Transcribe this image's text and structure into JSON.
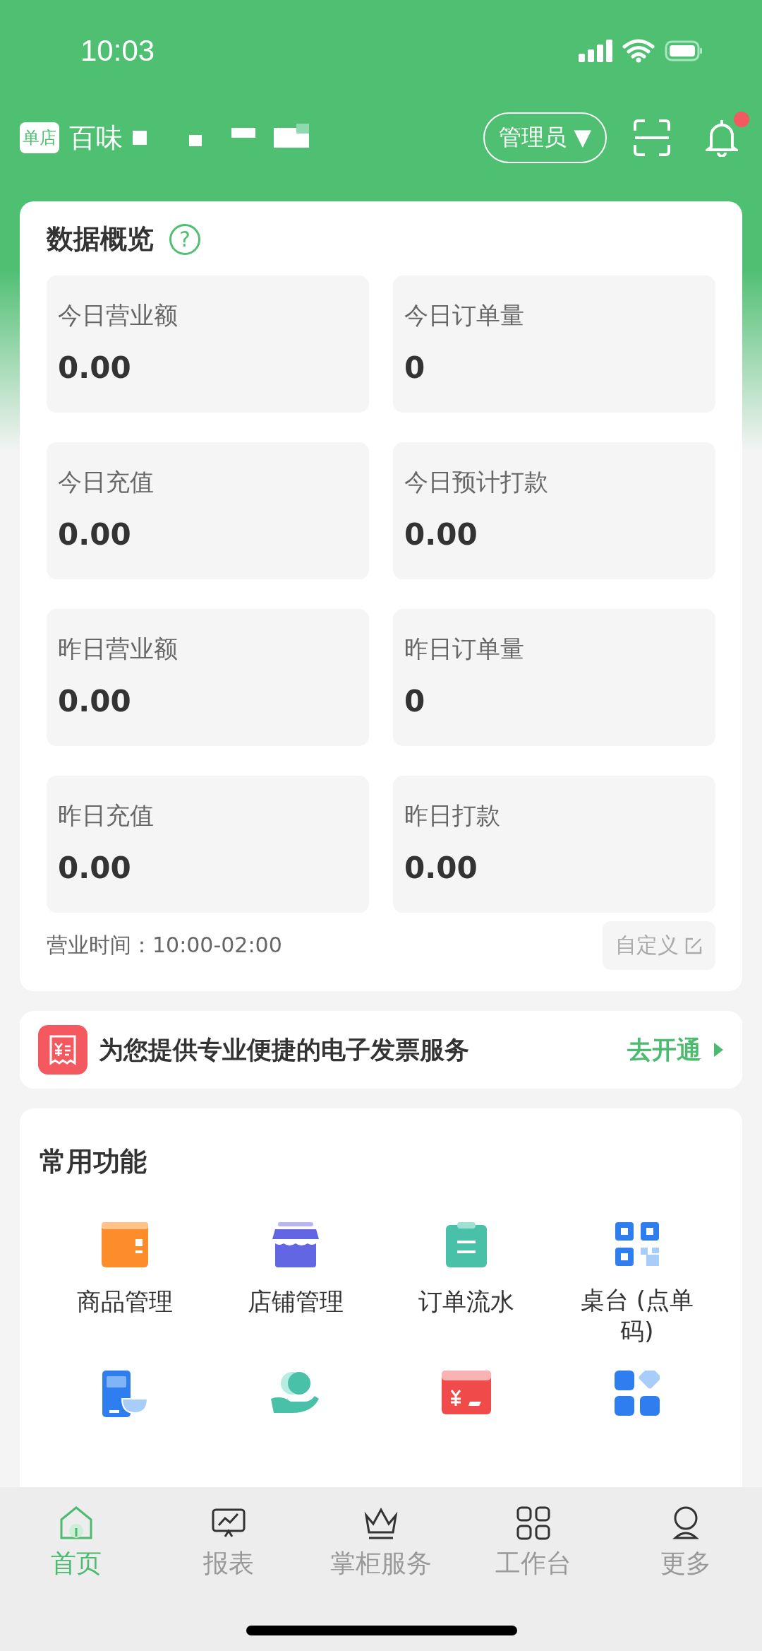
{
  "status_bar": {
    "time": "10:03"
  },
  "header": {
    "store_tag": "单店",
    "store_name": "百味",
    "role_button": "管理员 ▼",
    "notification_dot": true
  },
  "overview": {
    "title": "数据概览",
    "help_icon": "?",
    "tiles": [
      {
        "label": "今日营业额",
        "value": "0.00"
      },
      {
        "label": "今日订单量",
        "value": "0"
      },
      {
        "label": "今日充值",
        "value": "0.00"
      },
      {
        "label": "今日预计打款",
        "value": "0.00"
      },
      {
        "label": "昨日营业额",
        "value": "0.00"
      },
      {
        "label": "昨日订单量",
        "value": "0"
      },
      {
        "label": "昨日充值",
        "value": "0.00"
      },
      {
        "label": "昨日打款",
        "value": "0.00"
      }
    ],
    "business_hours": "营业时间：10:00-02:00",
    "customize_button": "自定义"
  },
  "invoice_banner": {
    "text": "为您提供专业便捷的电子发票服务",
    "action": "去开通"
  },
  "functions": {
    "title": "常用功能",
    "items": [
      {
        "kind": "box",
        "label": "商品管理"
      },
      {
        "kind": "store",
        "label": "店铺管理"
      },
      {
        "kind": "clipboard",
        "label": "订单流水"
      },
      {
        "kind": "qr",
        "label": "桌台 (点单码)"
      },
      {
        "kind": "phone"
      },
      {
        "kind": "hand"
      },
      {
        "kind": "card"
      },
      {
        "kind": "apps"
      }
    ]
  },
  "tab_bar": [
    {
      "kind": "home",
      "label": "首页",
      "selected": true
    },
    {
      "kind": "report",
      "label": "报表",
      "selected": false
    },
    {
      "kind": "crown",
      "label": "掌柜服务",
      "selected": false
    },
    {
      "kind": "grid",
      "label": "工作台",
      "selected": false
    },
    {
      "kind": "person",
      "label": "更多",
      "selected": false
    }
  ]
}
